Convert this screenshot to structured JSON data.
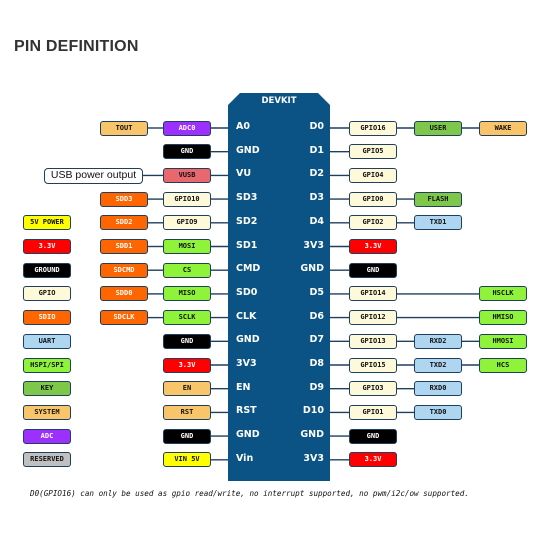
{
  "title": "PIN DEFINITION",
  "board": {
    "label": "DEVKIT",
    "color": "#0b5384"
  },
  "colors": {
    "tout": "#f9c56b",
    "adc": "#9b30ff",
    "gnd": "#000000",
    "vusb": "#e8686d",
    "sdio": "#ff6600",
    "gpio": "#fef9d9",
    "power5v": "#ffff00",
    "v33": "#ff0000",
    "hspi": "#8ff33a",
    "key": "#7dc84a",
    "system": "#f9c56b",
    "reserved": "#c0c0c0",
    "uart": "#aed6f1",
    "border": "#1f3f5f"
  },
  "legend": [
    {
      "label": "5V POWER",
      "bg": "#ffff00",
      "fg": "#111111"
    },
    {
      "label": "3.3V",
      "bg": "#ff0000",
      "fg": "#ffffff"
    },
    {
      "label": "GROUND",
      "bg": "#000000",
      "fg": "#ffffff"
    },
    {
      "label": "GPIO",
      "bg": "#fef9d9",
      "fg": "#111111"
    },
    {
      "label": "SDIO",
      "bg": "#ff6600",
      "fg": "#ffffff"
    },
    {
      "label": "UART",
      "bg": "#aed6f1",
      "fg": "#111111"
    },
    {
      "label": "HSPI/SPI",
      "bg": "#8ff33a",
      "fg": "#111111"
    },
    {
      "label": "KEY",
      "bg": "#7dc84a",
      "fg": "#111111"
    },
    {
      "label": "SYSTEM",
      "bg": "#f9c56b",
      "fg": "#111111"
    },
    {
      "label": "ADC",
      "bg": "#9b30ff",
      "fg": "#ffffff"
    },
    {
      "label": "RESERVED",
      "bg": "#c0c0c0",
      "fg": "#111111"
    }
  ],
  "usb_note": "USB power output",
  "left_pins": [
    {
      "pin": "A0",
      "near": {
        "label": "ADC0",
        "bg": "#9b30ff",
        "fg": "#ffffff"
      },
      "far": {
        "label": "TOUT",
        "bg": "#f9c56b",
        "fg": "#111111"
      }
    },
    {
      "pin": "GND",
      "near": {
        "label": "GND",
        "bg": "#000000",
        "fg": "#ffffff"
      }
    },
    {
      "pin": "VU",
      "near": {
        "label": "VUSB",
        "bg": "#e8686d",
        "fg": "#111111"
      }
    },
    {
      "pin": "SD3",
      "near": {
        "label": "GPIO10",
        "bg": "#fef9d9",
        "fg": "#111111"
      },
      "far": {
        "label": "SDD3",
        "bg": "#ff6600",
        "fg": "#ffffff"
      }
    },
    {
      "pin": "SD2",
      "near": {
        "label": "GPIO9",
        "bg": "#fef9d9",
        "fg": "#111111"
      },
      "far": {
        "label": "SDD2",
        "bg": "#ff6600",
        "fg": "#ffffff"
      }
    },
    {
      "pin": "SD1",
      "near": {
        "label": "MOSI",
        "bg": "#8ff33a",
        "fg": "#111111"
      },
      "far": {
        "label": "SDD1",
        "bg": "#ff6600",
        "fg": "#ffffff"
      }
    },
    {
      "pin": "CMD",
      "near": {
        "label": "CS",
        "bg": "#8ff33a",
        "fg": "#111111"
      },
      "far": {
        "label": "SDCMD",
        "bg": "#ff6600",
        "fg": "#ffffff"
      }
    },
    {
      "pin": "SD0",
      "near": {
        "label": "MISO",
        "bg": "#8ff33a",
        "fg": "#111111"
      },
      "far": {
        "label": "SDD0",
        "bg": "#ff6600",
        "fg": "#ffffff"
      }
    },
    {
      "pin": "CLK",
      "near": {
        "label": "SCLK",
        "bg": "#8ff33a",
        "fg": "#111111"
      },
      "far": {
        "label": "SDCLK",
        "bg": "#ff6600",
        "fg": "#ffffff"
      }
    },
    {
      "pin": "GND",
      "near": {
        "label": "GND",
        "bg": "#000000",
        "fg": "#ffffff"
      }
    },
    {
      "pin": "3V3",
      "near": {
        "label": "3.3V",
        "bg": "#ff0000",
        "fg": "#ffffff"
      }
    },
    {
      "pin": "EN",
      "near": {
        "label": "EN",
        "bg": "#f9c56b",
        "fg": "#111111"
      }
    },
    {
      "pin": "RST",
      "near": {
        "label": "RST",
        "bg": "#f9c56b",
        "fg": "#111111"
      }
    },
    {
      "pin": "GND",
      "near": {
        "label": "GND",
        "bg": "#000000",
        "fg": "#ffffff"
      }
    },
    {
      "pin": "Vin",
      "near": {
        "label": "VIN 5V",
        "bg": "#ffff00",
        "fg": "#111111"
      }
    }
  ],
  "right_pins": [
    {
      "pin": "D0",
      "near": {
        "label": "GPIO16",
        "bg": "#fef9d9",
        "fg": "#111111"
      },
      "mid": {
        "label": "USER",
        "bg": "#7dc84a",
        "fg": "#111111"
      },
      "far": {
        "label": "WAKE",
        "bg": "#f9c56b",
        "fg": "#111111"
      }
    },
    {
      "pin": "D1",
      "near": {
        "label": "GPIO5",
        "bg": "#fef9d9",
        "fg": "#111111"
      }
    },
    {
      "pin": "D2",
      "near": {
        "label": "GPIO4",
        "bg": "#fef9d9",
        "fg": "#111111"
      }
    },
    {
      "pin": "D3",
      "near": {
        "label": "GPIO0",
        "bg": "#fef9d9",
        "fg": "#111111"
      },
      "mid": {
        "label": "FLASH",
        "bg": "#7dc84a",
        "fg": "#111111"
      }
    },
    {
      "pin": "D4",
      "near": {
        "label": "GPIO2",
        "bg": "#fef9d9",
        "fg": "#111111"
      },
      "mid": {
        "label": "TXD1",
        "bg": "#aed6f1",
        "fg": "#111111"
      }
    },
    {
      "pin": "3V3",
      "near": {
        "label": "3.3V",
        "bg": "#ff0000",
        "fg": "#ffffff"
      }
    },
    {
      "pin": "GND",
      "near": {
        "label": "GND",
        "bg": "#000000",
        "fg": "#ffffff"
      }
    },
    {
      "pin": "D5",
      "near": {
        "label": "GPIO14",
        "bg": "#fef9d9",
        "fg": "#111111"
      },
      "far": {
        "label": "HSCLK",
        "bg": "#8ff33a",
        "fg": "#111111"
      }
    },
    {
      "pin": "D6",
      "near": {
        "label": "GPIO12",
        "bg": "#fef9d9",
        "fg": "#111111"
      },
      "far": {
        "label": "HMISO",
        "bg": "#8ff33a",
        "fg": "#111111"
      }
    },
    {
      "pin": "D7",
      "near": {
        "label": "GPIO13",
        "bg": "#fef9d9",
        "fg": "#111111"
      },
      "mid": {
        "label": "RXD2",
        "bg": "#aed6f1",
        "fg": "#111111"
      },
      "far": {
        "label": "HMOSI",
        "bg": "#8ff33a",
        "fg": "#111111"
      }
    },
    {
      "pin": "D8",
      "near": {
        "label": "GPIO15",
        "bg": "#fef9d9",
        "fg": "#111111"
      },
      "mid": {
        "label": "TXD2",
        "bg": "#aed6f1",
        "fg": "#111111"
      },
      "far": {
        "label": "HCS",
        "bg": "#8ff33a",
        "fg": "#111111"
      }
    },
    {
      "pin": "D9",
      "near": {
        "label": "GPIO3",
        "bg": "#fef9d9",
        "fg": "#111111"
      },
      "mid": {
        "label": "RXD0",
        "bg": "#aed6f1",
        "fg": "#111111"
      }
    },
    {
      "pin": "D10",
      "near": {
        "label": "GPIO1",
        "bg": "#fef9d9",
        "fg": "#111111"
      },
      "mid": {
        "label": "TXD0",
        "bg": "#aed6f1",
        "fg": "#111111"
      }
    },
    {
      "pin": "GND",
      "near": {
        "label": "GND",
        "bg": "#000000",
        "fg": "#ffffff"
      }
    },
    {
      "pin": "3V3",
      "near": {
        "label": "3.3V",
        "bg": "#ff0000",
        "fg": "#ffffff"
      }
    }
  ],
  "footnote": "D0(GPIO16) can only be used as gpio read/write, no interrupt supported, no pwm/i2c/ow supported."
}
